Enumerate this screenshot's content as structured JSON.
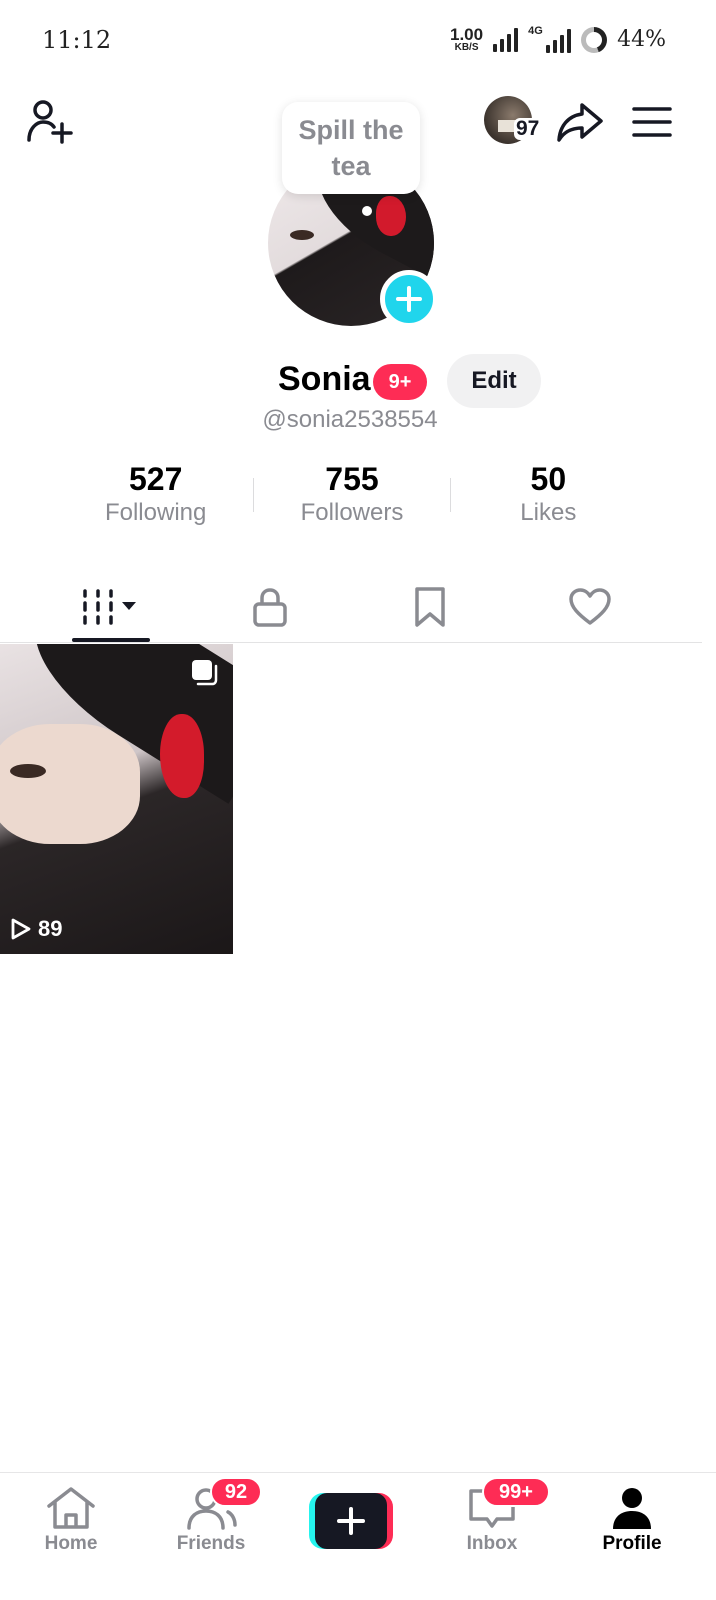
{
  "status_bar": {
    "time": "11:12",
    "net_speed_value": "1.00",
    "net_speed_unit": "KB/S",
    "network_type": "4G",
    "battery": "44%"
  },
  "header": {
    "story_count": "97",
    "avatar_bubble": "Spill the tea"
  },
  "profile": {
    "display_name": "Sonia",
    "notification_badge": "9+",
    "edit_label": "Edit",
    "username": "@sonia2538554"
  },
  "stats": [
    {
      "value": "527",
      "label": "Following"
    },
    {
      "value": "755",
      "label": "Followers"
    },
    {
      "value": "50",
      "label": "Likes"
    }
  ],
  "tabs": [
    {
      "icon": "grid-icon",
      "active": true
    },
    {
      "icon": "lock-icon",
      "active": false
    },
    {
      "icon": "bookmark-icon",
      "active": false
    },
    {
      "icon": "heart-icon",
      "active": false
    }
  ],
  "videos": [
    {
      "views": "89"
    }
  ],
  "bottom_nav": {
    "home": "Home",
    "friends": "Friends",
    "friends_badge": "92",
    "inbox": "Inbox",
    "inbox_badge": "99+",
    "profile": "Profile"
  },
  "colors": {
    "accent": "#fe2c55",
    "cyan": "#20d5ec",
    "text_primary": "#161823",
    "text_secondary": "#8a8b91"
  }
}
